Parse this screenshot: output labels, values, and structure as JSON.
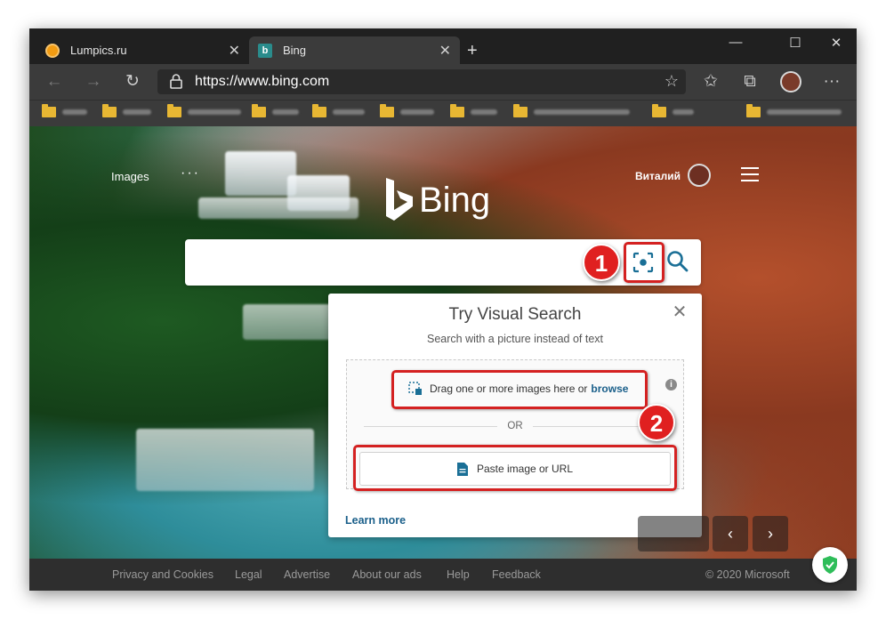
{
  "browser": {
    "tabs": [
      {
        "title": "Lumpics.ru",
        "active": false,
        "favicon": "lumpics-icon"
      },
      {
        "title": "Bing",
        "active": true,
        "favicon": "bing-icon"
      }
    ],
    "tab_close_glyph": "✕",
    "new_tab_glyph": "+",
    "window_controls": {
      "minimize": "—",
      "maximize": "☐",
      "close": "✕"
    },
    "nav": {
      "back": "←",
      "forward": "→",
      "refresh": "↻"
    },
    "address": {
      "url": "https://www.bing.com",
      "star_glyph": "☆"
    },
    "toolbar_icons": {
      "favorites": "✩",
      "collections": "⧉",
      "more": "···"
    }
  },
  "page": {
    "header": {
      "images_link": "Images",
      "more_dots": "···",
      "user_name": "Виталий"
    },
    "logo_text": "Bing",
    "search": {
      "value": ""
    },
    "visual_search": {
      "title": "Try Visual Search",
      "subtitle": "Search with a picture instead of text",
      "close_glyph": "✕",
      "info_glyph": "i",
      "drag_text": "Drag one or more images here or",
      "browse_label": "browse",
      "or_label": "OR",
      "paste_label": "Paste image or URL",
      "learn_more": "Learn more"
    },
    "callouts": [
      "1",
      "2"
    ],
    "nav_arrows": {
      "prev": "‹",
      "next": "›"
    }
  },
  "footer": {
    "links": [
      "Privacy and Cookies",
      "Legal",
      "Advertise",
      "About our ads",
      "Help",
      "Feedback"
    ],
    "copyright": "© 2020 Microsoft"
  },
  "colors": {
    "accent_link": "#1a5f8a",
    "callout_red": "#e02020",
    "shield_green": "#2ebd59",
    "folder_yellow": "#e8b733"
  }
}
